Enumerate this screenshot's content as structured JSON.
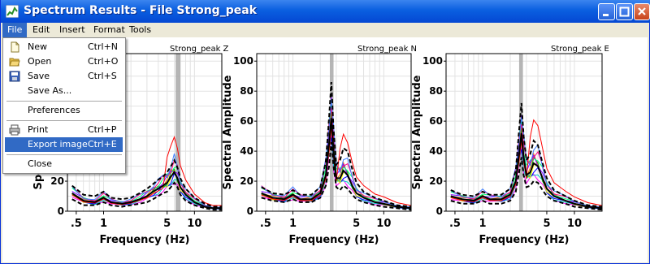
{
  "window": {
    "title": "Spectrum Results - File Strong_peak"
  },
  "menubar": {
    "items": [
      "File",
      "Edit",
      "Insert",
      "Format",
      "Tools"
    ]
  },
  "file_menu": {
    "items": [
      {
        "label": "New",
        "shortcut": "Ctrl+N",
        "icon": "new-document-icon"
      },
      {
        "label": "Open",
        "shortcut": "Ctrl+O",
        "icon": "open-folder-icon"
      },
      {
        "label": "Save",
        "shortcut": "Ctrl+S",
        "icon": "save-disk-icon"
      },
      {
        "label": "Save As...",
        "shortcut": ""
      },
      {
        "label": "Preferences",
        "shortcut": ""
      },
      {
        "label": "Print",
        "shortcut": "Ctrl+P",
        "icon": "printer-icon"
      },
      {
        "label": "Export image",
        "shortcut": "Ctrl+E",
        "highlighted": true
      },
      {
        "label": "Close",
        "shortcut": ""
      }
    ]
  },
  "colors": {
    "title_blue": "#0a5fe0",
    "menu_highlight": "#316ac5",
    "peak_band": "#a8a8a8",
    "mean_curve": "#000000",
    "red_curve": "#ff0000"
  },
  "chart_data": [
    {
      "type": "line",
      "title": "Strong_peak Z",
      "xlabel": "Frequency (Hz)",
      "ylabel": "Spectral Amplitude",
      "xscale": "log",
      "xlim": [
        0.4,
        20
      ],
      "ylim": [
        0,
        105
      ],
      "xticks": [
        ".5",
        "1",
        "5",
        "10"
      ],
      "yticks": [
        "0",
        "20",
        "40",
        "60",
        "80",
        "100"
      ],
      "grid": true,
      "peak_band_hz": [
        6.2,
        7.0
      ],
      "series": [
        {
          "style": "mean",
          "x": [
            0.45,
            0.6,
            0.8,
            1.0,
            1.2,
            1.6,
            2.0,
            2.5,
            3.0,
            3.5,
            4.0,
            4.5,
            5.0,
            5.5,
            6.0,
            6.5,
            7.0,
            8.0,
            10,
            13,
            16,
            20
          ],
          "y": [
            12,
            7,
            6,
            9,
            6,
            5,
            6,
            8,
            10,
            13,
            15,
            17,
            19,
            23,
            26,
            22,
            16,
            11,
            6,
            3,
            2,
            2
          ]
        },
        {
          "style": "std-dashed",
          "x": [
            0.45,
            0.6,
            0.8,
            1.0,
            1.2,
            1.6,
            2.0,
            2.5,
            3.0,
            3.5,
            4.0,
            4.5,
            5.0,
            5.5,
            6.0,
            6.5,
            7.0,
            8.0,
            10,
            13,
            16,
            20
          ],
          "y": [
            17,
            11,
            10,
            13,
            9,
            8,
            9,
            12,
            15,
            18,
            21,
            23,
            26,
            30,
            34,
            29,
            22,
            15,
            9,
            5,
            3,
            3
          ]
        },
        {
          "style": "std-dashed",
          "x": [
            0.45,
            0.6,
            0.8,
            1.0,
            1.2,
            1.6,
            2.0,
            2.5,
            3.0,
            3.5,
            4.0,
            4.5,
            5.0,
            5.5,
            6.0,
            6.5,
            7.0,
            8.0,
            10,
            13,
            16,
            20
          ],
          "y": [
            8,
            4,
            4,
            6,
            4,
            3,
            4,
            5,
            6,
            8,
            10,
            12,
            13,
            16,
            19,
            16,
            11,
            7,
            4,
            2,
            1,
            1
          ]
        }
      ]
    },
    {
      "type": "line",
      "title": "Strong_peak N",
      "xlabel": "Frequency (Hz)",
      "ylabel": "Spectral Amplitude",
      "xscale": "log",
      "xlim": [
        0.4,
        20
      ],
      "ylim": [
        0,
        105
      ],
      "xticks": [
        ".5",
        "1",
        "5",
        "10"
      ],
      "yticks": [
        "0",
        "20",
        "40",
        "60",
        "80",
        "100"
      ],
      "grid": true,
      "peak_band_hz": [
        2.55,
        2.8
      ],
      "series": [
        {
          "style": "mean",
          "x": [
            0.45,
            0.6,
            0.8,
            1.0,
            1.2,
            1.6,
            2.0,
            2.3,
            2.5,
            2.65,
            2.8,
            3.0,
            3.3,
            3.6,
            4.0,
            4.5,
            5.0,
            6.0,
            8.0,
            10,
            14,
            20
          ],
          "y": [
            12,
            9,
            8,
            11,
            8,
            8,
            12,
            24,
            45,
            62,
            40,
            22,
            22,
            27,
            24,
            17,
            12,
            9,
            6,
            5,
            3,
            2
          ]
        },
        {
          "style": "std-dashed",
          "x": [
            0.45,
            0.6,
            0.8,
            1.0,
            1.2,
            1.6,
            2.0,
            2.3,
            2.5,
            2.65,
            2.8,
            3.0,
            3.3,
            3.6,
            4.0,
            4.5,
            5.0,
            6.0,
            8.0,
            10,
            14,
            20
          ],
          "y": [
            16,
            12,
            11,
            14,
            11,
            11,
            16,
            33,
            62,
            86,
            55,
            31,
            34,
            42,
            40,
            28,
            19,
            13,
            9,
            7,
            4,
            3
          ]
        },
        {
          "style": "std-dashed",
          "x": [
            0.45,
            0.6,
            0.8,
            1.0,
            1.2,
            1.6,
            2.0,
            2.3,
            2.5,
            2.65,
            2.8,
            3.0,
            3.3,
            3.6,
            4.0,
            4.5,
            5.0,
            6.0,
            8.0,
            10,
            14,
            20
          ],
          "y": [
            9,
            7,
            6,
            8,
            6,
            6,
            9,
            17,
            30,
            46,
            30,
            16,
            14,
            17,
            15,
            11,
            8,
            6,
            4,
            3,
            2,
            1
          ]
        }
      ]
    },
    {
      "type": "line",
      "title": "Strong_peak E",
      "xlabel": "Frequency (Hz)",
      "ylabel": "Spectral Amplitude",
      "xscale": "log",
      "xlim": [
        0.4,
        20
      ],
      "ylim": [
        0,
        105
      ],
      "xticks": [
        ".5",
        "1",
        "5",
        "10"
      ],
      "yticks": [
        "0",
        "20",
        "40",
        "60",
        "80",
        "100"
      ],
      "grid": true,
      "peak_band_hz": [
        2.5,
        2.75
      ],
      "series": [
        {
          "style": "mean",
          "x": [
            0.45,
            0.6,
            0.8,
            1.0,
            1.2,
            1.6,
            2.0,
            2.3,
            2.5,
            2.65,
            2.8,
            3.0,
            3.3,
            3.6,
            4.0,
            4.5,
            5.0,
            6.0,
            8.0,
            10,
            14,
            20
          ],
          "y": [
            10,
            8,
            7,
            10,
            8,
            8,
            11,
            20,
            38,
            52,
            36,
            24,
            26,
            32,
            30,
            22,
            15,
            10,
            7,
            5,
            3,
            2
          ]
        },
        {
          "style": "std-dashed",
          "x": [
            0.45,
            0.6,
            0.8,
            1.0,
            1.2,
            1.6,
            2.0,
            2.3,
            2.5,
            2.65,
            2.8,
            3.0,
            3.3,
            3.6,
            4.0,
            4.5,
            5.0,
            6.0,
            8.0,
            10,
            14,
            20
          ],
          "y": [
            14,
            11,
            10,
            13,
            11,
            11,
            15,
            27,
            54,
            72,
            50,
            34,
            38,
            47,
            44,
            32,
            22,
            14,
            10,
            7,
            4,
            3
          ]
        },
        {
          "style": "std-dashed",
          "x": [
            0.45,
            0.6,
            0.8,
            1.0,
            1.2,
            1.6,
            2.0,
            2.3,
            2.5,
            2.65,
            2.8,
            3.0,
            3.3,
            3.6,
            4.0,
            4.5,
            5.0,
            6.0,
            8.0,
            10,
            14,
            20
          ],
          "y": [
            7,
            5,
            5,
            7,
            5,
            5,
            7,
            13,
            26,
            36,
            24,
            16,
            17,
            20,
            19,
            14,
            10,
            7,
            5,
            3,
            2,
            1
          ]
        }
      ]
    }
  ]
}
